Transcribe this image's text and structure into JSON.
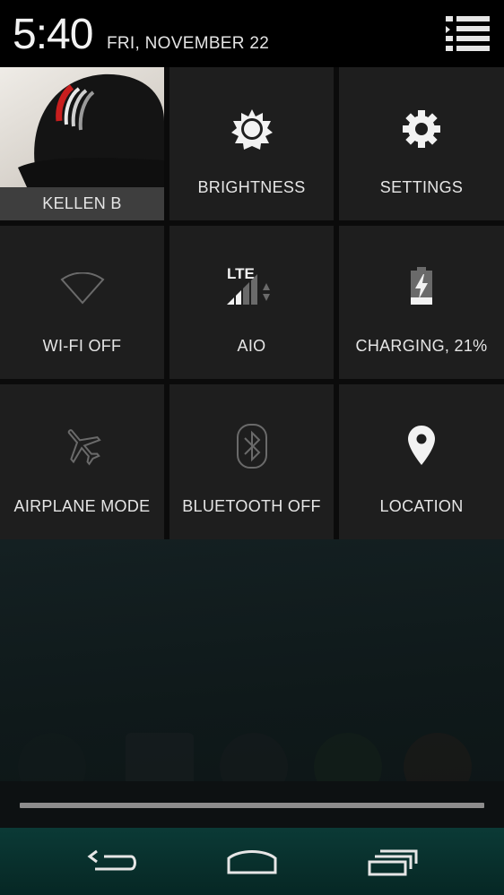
{
  "status_bar": {
    "time": "5:40",
    "date": "FRI, NOVEMBER 22",
    "notifications_icon": "notification-list-icon"
  },
  "quick_settings": {
    "user": {
      "name": "KELLEN B",
      "icon": "user-photo-cap"
    },
    "brightness": {
      "label": "BRIGHTNESS",
      "icon": "brightness-icon"
    },
    "settings": {
      "label": "SETTINGS",
      "icon": "gear-icon"
    },
    "wifi": {
      "label": "WI-FI OFF",
      "icon": "wifi-off-icon",
      "enabled": false
    },
    "mobile": {
      "label": "AIO",
      "network": "LTE",
      "icon": "signal-icon"
    },
    "battery": {
      "label": "CHARGING, 21%",
      "icon": "battery-charging-icon",
      "level_percent": 21
    },
    "airplane": {
      "label": "AIRPLANE MODE",
      "icon": "airplane-icon",
      "enabled": false
    },
    "bluetooth": {
      "label": "BLUETOOTH OFF",
      "icon": "bluetooth-icon",
      "enabled": false
    },
    "location": {
      "label": "LOCATION",
      "icon": "location-pin-icon",
      "enabled": true
    }
  },
  "nav_bar": {
    "back_icon": "back-icon",
    "home_icon": "home-icon",
    "recents_icon": "recents-icon"
  },
  "colors": {
    "tile_bg": "#1e1e1e",
    "navbar": "#0b3a36",
    "inactive_icon": "#6a6a6a",
    "active_icon": "#ffffff"
  }
}
